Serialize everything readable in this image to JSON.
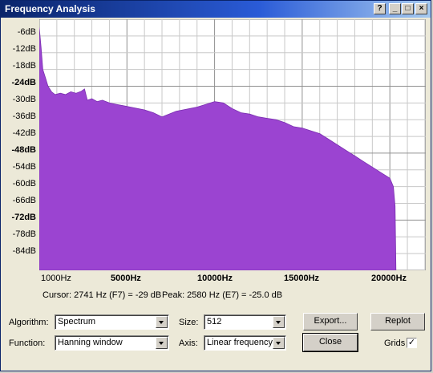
{
  "window": {
    "title": "Frequency Analysis"
  },
  "plot": {
    "y_labels": [
      {
        "text": "-6dB",
        "bold": false
      },
      {
        "text": "-12dB",
        "bold": false
      },
      {
        "text": "-18dB",
        "bold": false
      },
      {
        "text": "-24dB",
        "bold": true
      },
      {
        "text": "-30dB",
        "bold": false
      },
      {
        "text": "-36dB",
        "bold": false
      },
      {
        "text": "-42dB",
        "bold": false
      },
      {
        "text": "-48dB",
        "bold": true
      },
      {
        "text": "-54dB",
        "bold": false
      },
      {
        "text": "-60dB",
        "bold": false
      },
      {
        "text": "-66dB",
        "bold": false
      },
      {
        "text": "-72dB",
        "bold": true
      },
      {
        "text": "-78dB",
        "bold": false
      },
      {
        "text": "-84dB",
        "bold": false
      }
    ],
    "x_labels": [
      {
        "text": "1000Hz",
        "bold": false
      },
      {
        "text": "5000Hz",
        "bold": true
      },
      {
        "text": "10000Hz",
        "bold": true
      },
      {
        "text": "15000Hz",
        "bold": true
      },
      {
        "text": "20000Hz",
        "bold": true
      }
    ],
    "fill_color": "#9b44d1",
    "grid_color": "#c8c8c8",
    "spectrum_db": [
      [
        0,
        -3
      ],
      [
        100,
        -10
      ],
      [
        200,
        -18
      ],
      [
        350,
        -21
      ],
      [
        500,
        -24
      ],
      [
        700,
        -26
      ],
      [
        900,
        -27
      ],
      [
        1200,
        -26.5
      ],
      [
        1500,
        -27
      ],
      [
        1800,
        -26
      ],
      [
        2100,
        -26.5
      ],
      [
        2400,
        -25.8
      ],
      [
        2580,
        -25
      ],
      [
        2741,
        -29
      ],
      [
        3000,
        -28.5
      ],
      [
        3300,
        -29.5
      ],
      [
        3600,
        -29
      ],
      [
        4000,
        -30
      ],
      [
        4400,
        -30.5
      ],
      [
        4800,
        -31
      ],
      [
        5200,
        -31.5
      ],
      [
        5600,
        -32
      ],
      [
        6000,
        -32.5
      ],
      [
        6500,
        -33.5
      ],
      [
        7000,
        -35
      ],
      [
        7400,
        -34
      ],
      [
        7800,
        -33
      ],
      [
        8200,
        -32.5
      ],
      [
        8600,
        -32
      ],
      [
        9000,
        -31.5
      ],
      [
        9500,
        -30.5
      ],
      [
        10000,
        -29.5
      ],
      [
        10500,
        -30
      ],
      [
        11000,
        -32
      ],
      [
        11500,
        -33.5
      ],
      [
        12000,
        -34
      ],
      [
        12500,
        -35
      ],
      [
        13000,
        -35.5
      ],
      [
        13500,
        -36
      ],
      [
        14000,
        -37
      ],
      [
        14500,
        -38.5
      ],
      [
        15000,
        -39
      ],
      [
        15500,
        -40
      ],
      [
        16000,
        -41
      ],
      [
        16500,
        -43
      ],
      [
        17000,
        -45
      ],
      [
        17500,
        -47
      ],
      [
        18000,
        -49
      ],
      [
        18500,
        -51
      ],
      [
        19000,
        -53
      ],
      [
        19500,
        -55
      ],
      [
        20000,
        -57
      ],
      [
        20200,
        -60
      ],
      [
        20300,
        -67
      ],
      [
        20350,
        -90
      ]
    ]
  },
  "status": {
    "cursor": "Cursor: 2741 Hz (F7) = -29 dB",
    "peak": "Peak: 2580 Hz (E7) = -25.0 dB"
  },
  "controls": {
    "algorithm_label": "Algorithm:",
    "algorithm_value": "Spectrum",
    "size_label": "Size:",
    "size_value": "512",
    "function_label": "Function:",
    "function_value": "Hanning window",
    "axis_label": "Axis:",
    "axis_value": "Linear frequency",
    "export_label": "Export...",
    "replot_label": "Replot",
    "close_label": "Close",
    "grids_label": "Grids",
    "grids_checked": "✓"
  }
}
